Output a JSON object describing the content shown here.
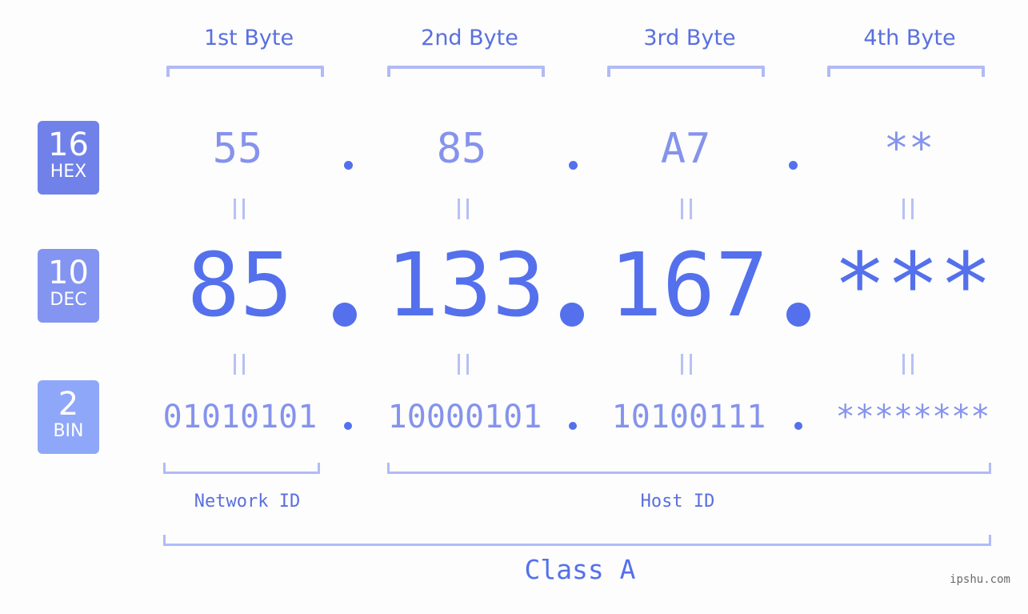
{
  "bytes": {
    "labels": [
      "1st Byte",
      "2nd Byte",
      "3rd Byte",
      "4th Byte"
    ]
  },
  "badges": {
    "hex": {
      "number": "16",
      "label": "HEX",
      "color": "#7081ea"
    },
    "dec": {
      "number": "10",
      "label": "DEC",
      "color": "#8394f1"
    },
    "bin": {
      "number": "2",
      "label": "BIN",
      "color": "#8fa7f9"
    }
  },
  "hex_values": [
    "55",
    "85",
    "A7",
    "**"
  ],
  "dec_values": [
    "85",
    "133",
    "167",
    "***"
  ],
  "bin_values": [
    "01010101",
    "10000101",
    "10100111",
    "********"
  ],
  "separator": ".",
  "segments": {
    "network_id": "Network ID",
    "host_id": "Host ID",
    "ip_class": "Class A"
  },
  "watermark": "ipshu.com",
  "colors": {
    "primary": "#5470ec",
    "secondary": "#8593ec",
    "bracket": "#b1bbf6",
    "background": "#fcfdfc"
  }
}
